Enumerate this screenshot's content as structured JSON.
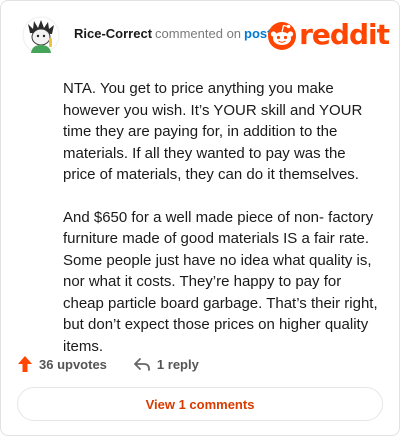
{
  "header": {
    "username": "Rice-Correct",
    "action_text": "commented on",
    "post_link": "post",
    "brand_name": "reddit",
    "brand_color": "#ff4500"
  },
  "comment": {
    "paragraphs": [
      "NTA. You get to price anything you make however you wish. It’s YOUR skill and YOUR time they are paying for, in addition to the materials. If all they wanted to pay was the price of materials, they can do it themselves.",
      "And $650 for a well made piece of non- factory furniture made of good materials IS a fair rate. Some people just have no idea what quality is, nor what it costs. They’re happy to pay for cheap particle board garbage. That’s their right, but don’t expect those prices on higher quality items."
    ]
  },
  "actions": {
    "upvotes_label": "36 upvotes",
    "upvote_icon": "upvote-arrow-icon",
    "upvote_color": "#ff4500",
    "reply_label": "1 reply",
    "reply_icon": "reply-arrow-icon"
  },
  "view_comments": {
    "label": "View 1 comments",
    "color": "#d93a00"
  }
}
